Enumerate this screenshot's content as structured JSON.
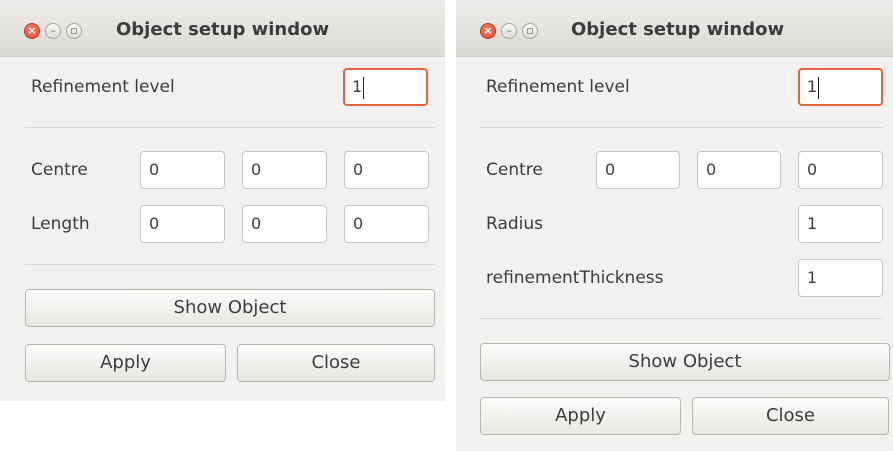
{
  "windows": [
    {
      "title": "Object setup window",
      "refinement_label": "Refinement level",
      "refinement_value": "1",
      "centre_label": "Centre",
      "centre_values": [
        "0",
        "0",
        "0"
      ],
      "length_label": "Length",
      "length_values": [
        "0",
        "0",
        "0"
      ],
      "show_object_label": "Show Object",
      "apply_label": "Apply",
      "close_label": "Close"
    },
    {
      "title": "Object setup window",
      "refinement_label": "Refinement level",
      "refinement_value": "1",
      "centre_label": "Centre",
      "centre_values": [
        "0",
        "0",
        "0"
      ],
      "radius_label": "Radius",
      "radius_value": "1",
      "thickness_label": "refinementThickness",
      "thickness_value": "1",
      "show_object_label": "Show Object",
      "apply_label": "Apply",
      "close_label": "Close"
    }
  ],
  "colors": {
    "focus_accent": "#e8643c",
    "close_button": "#df4a2a",
    "window_bg": "#f2f1f0"
  },
  "icons": {
    "close": "close-icon",
    "minimize": "minimize-icon",
    "maximize": "maximize-icon"
  }
}
